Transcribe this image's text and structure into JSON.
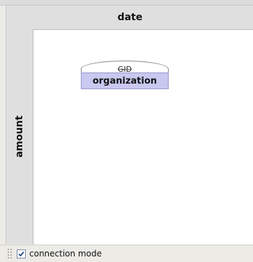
{
  "pivot": {
    "column_header": "date",
    "row_header": "amount"
  },
  "node": {
    "key_label": "GID",
    "name": "organization"
  },
  "status_bar": {
    "connection_mode_label": "connection mode",
    "connection_mode_checked": true
  },
  "colors": {
    "node_fill": "#c8c8f0",
    "canvas": "#ffffff"
  }
}
